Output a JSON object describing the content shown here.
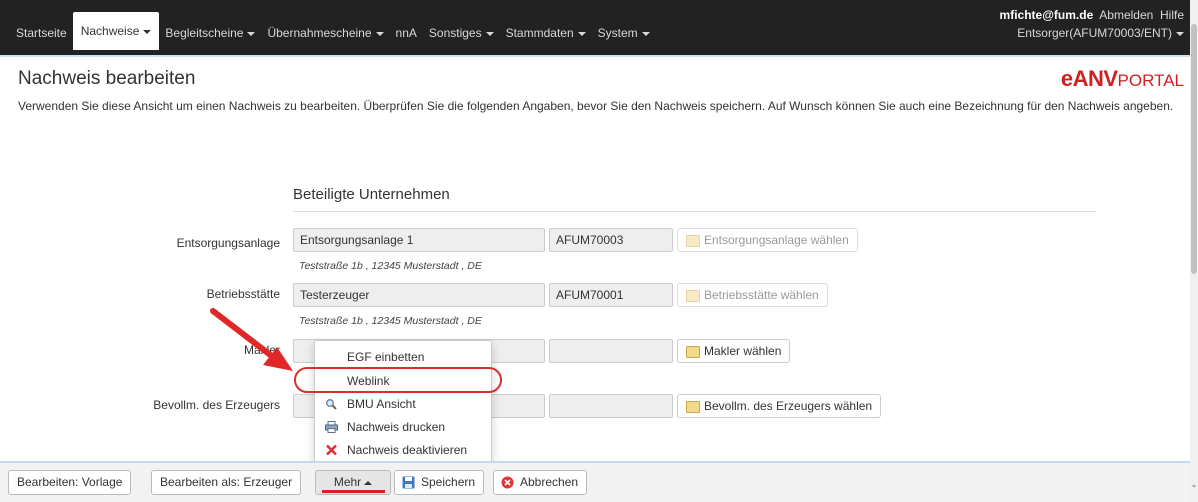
{
  "nav": {
    "items": [
      {
        "label": "Startseite",
        "caret": false,
        "active": false
      },
      {
        "label": "Nachweise",
        "caret": true,
        "active": true
      },
      {
        "label": "Begleitscheine",
        "caret": true,
        "active": false
      },
      {
        "label": "Übernahmescheine",
        "caret": true,
        "active": false
      },
      {
        "label": "nnA",
        "caret": false,
        "active": false
      },
      {
        "label": "Sonstiges",
        "caret": true,
        "active": false
      },
      {
        "label": "Stammdaten",
        "caret": true,
        "active": false
      },
      {
        "label": "System",
        "caret": true,
        "active": false
      }
    ],
    "user": "mfichte@fum.de",
    "logout": "Abmelden",
    "help": "Hilfe",
    "role": "Entsorger(AFUM70003/ENT)"
  },
  "page": {
    "title": "Nachweis bearbeiten",
    "logo_big": "eANV",
    "logo_small": "PORTAL",
    "intro": "Verwenden Sie diese Ansicht um einen Nachweis zu bearbeiten. Überprüfen Sie die folgenden Angaben, bevor Sie den Nachweis speichern. Auf Wunsch können Sie auch eine Bezeichnung für den Nachweis angeben."
  },
  "section": {
    "title": "Beteiligte Unternehmen",
    "rows": [
      {
        "label": "Entsorgungsanlage",
        "name": "Entsorgungsanlage 1",
        "id": "AFUM70003",
        "button": "Entsorgungsanlage wählen",
        "address": "Teststraße 1b , 12345 Musterstadt , DE"
      },
      {
        "label": "Betriebsstätte",
        "name": "Testerzeuger",
        "id": "AFUM70001",
        "button": "Betriebsstätte wählen",
        "address": "Teststraße 1b , 12345 Musterstadt , DE"
      },
      {
        "label": "Makler",
        "name": "",
        "id": "",
        "button": "Makler wählen",
        "address": ""
      },
      {
        "label": "Bevollm. des Erzeugers",
        "name": "",
        "id": "",
        "button": "Bevollm. des Erzeugers wählen",
        "address": ""
      }
    ]
  },
  "menu": {
    "items": [
      {
        "label": "EGF einbetten",
        "icon": "none"
      },
      {
        "label": "Weblink",
        "icon": "none"
      },
      {
        "label": "BMU Ansicht",
        "icon": "magnifier-icon"
      },
      {
        "label": "Nachweis drucken",
        "icon": "printer-icon"
      },
      {
        "label": "Nachweis deaktivieren",
        "icon": "red-x-icon"
      }
    ]
  },
  "toolbar": {
    "edit_template": "Bearbeiten: Vorlage",
    "edit_as": "Bearbeiten als: Erzeuger",
    "more": "Mehr",
    "save": "Speichern",
    "cancel": "Abbrechen"
  },
  "colors": {
    "navbar": "#222222",
    "accent_red": "#d9302c",
    "logo_red": "#cc2222",
    "toolbar_border": "#c4d8ee"
  }
}
